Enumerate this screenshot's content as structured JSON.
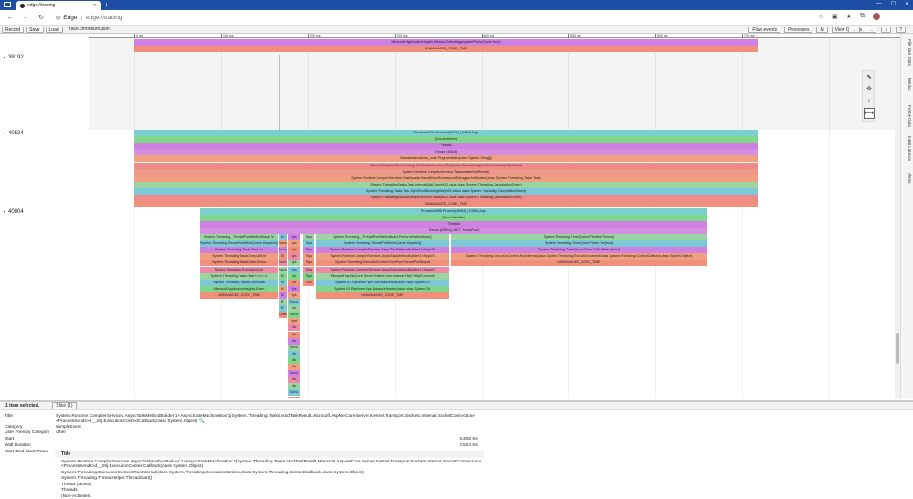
{
  "browser": {
    "tab_title": "edge://tracing",
    "brand": "Edge",
    "url": "edge://tracing",
    "new_tab": "+",
    "back": "←",
    "forward": "→",
    "refresh": "↻",
    "window_min": "—",
    "window_max": "☐",
    "window_close": "✕"
  },
  "toolbar": {
    "record": "Record",
    "save": "Save",
    "load": "Load",
    "filename": "trace.chromium.json",
    "flow_events": "Flow events",
    "processes": "Processes",
    "m": "M",
    "view_options": "View Options",
    "nav_prev": "←",
    "nav_next": "→",
    "zoom_in": "»",
    "help": "?"
  },
  "ruler": {
    "ticks": [
      "0 ms",
      "100 ms",
      "200 ms",
      "300 ms",
      "400 ms",
      "500 ms",
      "600 ms",
      "700 ms"
    ]
  },
  "processes": [
    {
      "id": "38192",
      "top_slices": [
        {
          "label": "Microsoft.ApplicationInsights.Metrics.DefaultAggregationPeriodCycle.Run()",
          "color": "#cf80e0"
        },
        {
          "label": "UNMANAGED_CODE_TIME",
          "color": "#f0907a"
        }
      ]
    },
    {
      "id": "40524",
      "slices": [
        {
          "label": "Process40524 Process(40524) (10984) Args",
          "color": "#7ccfcf"
        },
        {
          "label": "(Non-Activities)",
          "color": "#80d68a"
        },
        {
          "label": "Threads",
          "color": "#cf80e0"
        },
        {
          "label": "Thread (40524)",
          "color": "#d48fe3"
        },
        {
          "label": "NamedInstructions_code Program.Main(value System.String[])",
          "color": "#f0a080"
        },
        {
          "label": "Microsoft.AspNetCore.Hosting.WebHostExtensions.Run(class Microsoft.AspNetCore.Hosting.IWebHost)",
          "color": "#f08a8a"
        },
        {
          "label": "System.Runtime.CompilerServices.TaskAwaiter.GetResult()",
          "color": "#ee9a8a"
        },
        {
          "label": "System.Runtime.CompilerServices.TaskAwaiter.HandleNonSuccessAndDebuggerNotification(class System.Threading.Tasks.Task)",
          "color": "#f0a080"
        },
        {
          "label": "System.Threading.Tasks.Task.InternalWaitCore(int32,value class System.Threading.CancellationToken)",
          "color": "#9ad4a0"
        },
        {
          "label": "System.Threading.Tasks.Task.SpinThenBlockingWait(int32,value class System.Threading.CancellationToken)",
          "color": "#7cc8d6"
        },
        {
          "label": "System.Threading.ManualResetEventSlim.Wait(int32,value class System.Threading.CancellationToken)",
          "color": "#f08a8a"
        },
        {
          "label": "UNMANAGED_CODE_TIME",
          "color": "#f0907a"
        }
      ]
    },
    {
      "id": "40804",
      "slices": [
        {
          "label": "Process40804 Process(40804) (10984) Args",
          "color": "#7ccfcf"
        },
        {
          "label": "(Non-Activities)",
          "color": "#80d68a"
        },
        {
          "label": "Threads",
          "color": "#cf80e0"
        },
        {
          "label": "Thread (40804) (.NET ThreadPool)",
          "color": "#d48fe3"
        }
      ],
      "left_stack": [
        {
          "label": "System.Threading._ThreadPoolWaitCallback.Pe",
          "color": "#9ad4a0"
        },
        {
          "label": "System.Threading.ThreadPoolWorkQueue.Dispatch()",
          "color": "#7cc8d6"
        },
        {
          "label": "System.Threading.Tasks.Task.Ex",
          "color": "#cf80e0"
        },
        {
          "label": "System.Threading.Tasks.ExecuteEnt",
          "color": "#f0a080"
        },
        {
          "label": "System.Threading.Tasks.Task.Execu",
          "color": "#f0907a"
        },
        {
          "label": "System.Threading.ExecutionCont",
          "color": "#ee8aa6"
        },
        {
          "label": "System.Threading.Tasks.Task+<>c.<.c",
          "color": "#9ad4a0"
        },
        {
          "label": "System.Threading.Tasks.Continuati",
          "color": "#7cc8d6"
        },
        {
          "label": "Microsoft.ApplicationInsights.Exten",
          "color": "#80d68a"
        },
        {
          "label": "UNMANAGED_CODE_TIME",
          "color": "#f0907a"
        }
      ],
      "middle_stack": [
        {
          "label": "System.Threading._ThreadPoolWaitCallback.PerformWaitCallback()",
          "color": "#9ad4a0"
        },
        {
          "label": "System.Threading.ThreadPoolWorkQueue.Dispatch()",
          "color": "#7cc8d6"
        },
        {
          "label": "System.Runtime.CompilerServices.AsyncTaskMethodBuilder`1+AsyncSt",
          "color": "#cf80e0"
        },
        {
          "label": "System.Runtime.CompilerServices.AsyncTaskMethodBuilder`1+AsyncS",
          "color": "#f0a080"
        },
        {
          "label": "System.Threading.ExecutionContext.RunFromThreadPoolDispat",
          "color": "#f0907a"
        },
        {
          "label": "System.Runtime.CompilerServices.AsyncTaskMethodBuilder`1+AsyncS",
          "color": "#ee8aa6"
        },
        {
          "label": "Microsoft.AspNetCore.Server.Kestrel.Core.Internal.Http2.Http2Connecti",
          "color": "#9ad4a0"
        },
        {
          "label": "System.IO.Pipelines.Pipe.GetReadResult(value class System.IO",
          "color": "#7cc8d6"
        },
        {
          "label": "System.IO.Pipelines.Pipe.AdvanceReader(value class System.Se",
          "color": "#80d68a"
        },
        {
          "label": "UNMANAGED_CODE_TIME",
          "color": "#f0907a"
        }
      ],
      "right_stack": [
        {
          "label": "System.Threading.TimerQueue.FireNextTimers()",
          "color": "#9ad4a0"
        },
        {
          "label": "System.Threading.TimerQueueTimer.Fire(bool)",
          "color": "#7cc8d6"
        },
        {
          "label": "System.Threading.TimerQueueTimer.CallCallback(bool)",
          "color": "#cf80e0"
        },
        {
          "label": "System.Threading.ExecutionContext.RunInternal(class System.Threading.ExecutionContext,class System.Threading.ContextCallback,class System.Object)",
          "color": "#f0a080"
        },
        {
          "label": "UNMANAGED_CODE_TIME",
          "color": "#f0907a"
        }
      ],
      "narrow_col1": [
        "M.",
        "Micro",
        "Micro",
        "M.",
        "Micro",
        "Micro",
        "M.",
        "M.",
        "M.",
        "M.",
        "R.",
        "R.",
        "UNM"
      ],
      "narrow_col2": [
        "Sys",
        "Sys",
        "Sys",
        "Sys",
        "Sys",
        "Sys",
        "Mic",
        "UN",
        "Sys",
        "Sys",
        "Micro",
        "Mic",
        "Micro",
        "Syst",
        "Mic",
        "Mic",
        "Mic",
        "Micro",
        "Mic",
        "Mic",
        "Mic",
        "Micro",
        "Mic",
        "Mic",
        "Micro",
        "Mic"
      ],
      "narrow_col3": [
        "Sys",
        "Sys",
        "Sys",
        "Sys",
        "Sys",
        "Sys",
        "Sys",
        "UN"
      ]
    }
  ],
  "side_tabs": [
    "File Size Stats",
    "Metrics",
    "Frame Data",
    "Input Latency",
    "Alerts"
  ],
  "details": {
    "selection": "1 item selected.",
    "slice_tab": "Slice (1)",
    "title_key": "Title",
    "title_value": "System.Runtime.CompilerServices.AsyncTaskMethodBuilder`1+AsyncStateMachineBox`1[System.Threading.Tasks.VoidTaskResult,Microsoft.AspNetCore.Server.Kestrel.Transport.Sockets.Internal.SocketConnection+<ProcessSends>d__29].ExecutionContextCallback(class System.Object)",
    "category_key": "Category",
    "category_value": "sampleEvent",
    "ufc_key": "User Friendly Category",
    "ufc_value": "other",
    "start_key": "Start",
    "start_value": "8.308 ms",
    "wall_key": "Wall Duration",
    "wall_value": "0.524 ms",
    "stack_key": "Start+End Stack Trace",
    "stack_header": "Title",
    "stack": [
      "System.Runtime.CompilerServices.AsyncTaskMethodBuilder`1+AsyncStateMachineBox`1[System.Threading.Tasks.VoidTaskResult,Microsoft.AspNetCore.Server.Kestrel.Transport.Sockets.Internal.SocketConnection+<ProcessSends>d__29].ExecutionContextCallback(class System.Object)",
      "System.Threading.ExecutionContext.RunInternal(class System.Threading.ExecutionContext,class System.Threading.ContextCallback,class System.Object)",
      "System.Threading.ThreadHelper.ThreadStart()",
      "Thread (36360)",
      "Threads",
      "(Non-Activities)"
    ]
  }
}
